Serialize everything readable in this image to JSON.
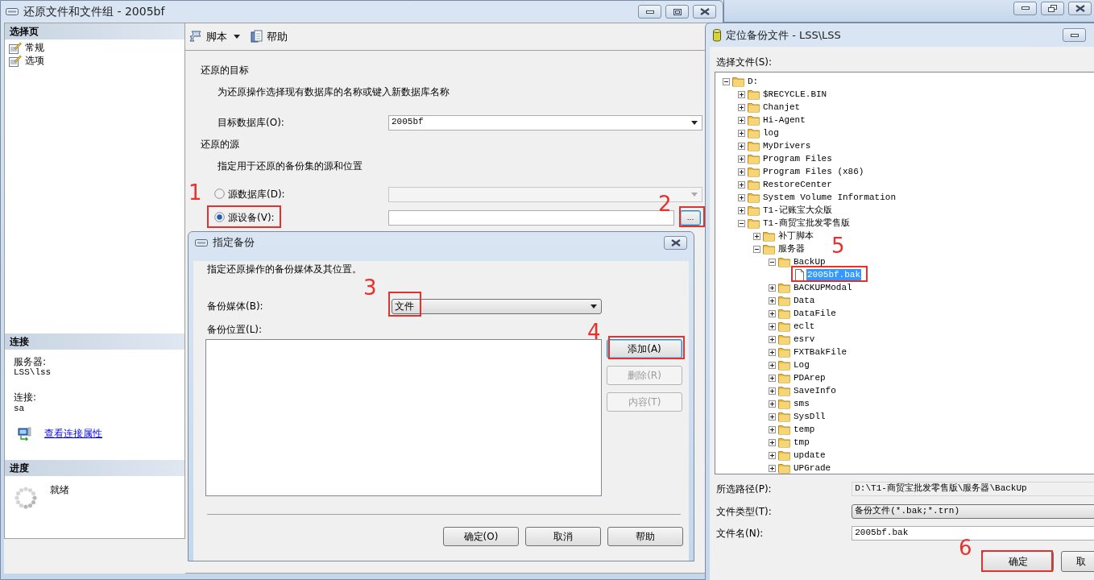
{
  "main_window": {
    "title": "还原文件和文件组 - 2005bf",
    "sidebar": {
      "header": "选择页",
      "items": [
        {
          "label": "常规",
          "selected": false
        },
        {
          "label": "选项",
          "selected": false
        }
      ]
    },
    "connection": {
      "header": "连接",
      "server_label": "服务器:",
      "server": "LSS\\lss",
      "login_label": "连接:",
      "login": "sa",
      "link": "查看连接属性"
    },
    "progress": {
      "header": "进度",
      "status": "就绪"
    },
    "toolbar": [
      {
        "label": "脚本",
        "kind": "script",
        "dropdown": true
      },
      {
        "label": "帮助",
        "kind": "help"
      }
    ],
    "destination": {
      "heading": "还原的目标",
      "hint": "为还原操作选择现有数据库的名称或键入新数据库名称",
      "database_label": "目标数据库(O):",
      "database": "2005bf"
    },
    "source": {
      "heading": "还原的源",
      "hint": "指定用于还原的备份集的源和位置",
      "options": [
        {
          "label": "源数据库(D):",
          "selected": false,
          "kind": "combo",
          "disabled": true
        },
        {
          "label": "源设备(V):",
          "selected": true,
          "kind": "browse",
          "disabled": false,
          "browse_button": "..."
        }
      ]
    }
  },
  "specify_dialog": {
    "title": "指定备份",
    "description": "指定还原操作的备份媒体及其位置。",
    "media_label": "备份媒体(B):",
    "media": "文件",
    "location_label": "备份位置(L):",
    "side_buttons": [
      {
        "label": "添加(A)",
        "disabled": false
      },
      {
        "label": "删除(R)",
        "disabled": true
      },
      {
        "label": "内容(T)",
        "disabled": true
      }
    ],
    "buttons": [
      {
        "label": "确定(O)"
      },
      {
        "label": "取消"
      },
      {
        "label": "帮助"
      }
    ]
  },
  "locate_dialog": {
    "title": "定位备份文件 - LSS\\LSS",
    "tree_label": "选择文件(S):",
    "tree": [
      {
        "label": "D:",
        "kind": "folder",
        "expanded": true,
        "selected": false,
        "children": [
          {
            "label": "$RECYCLE.BIN",
            "kind": "folder",
            "expanded": false,
            "selected": false
          },
          {
            "label": "Chanjet",
            "kind": "folder",
            "expanded": false,
            "selected": false
          },
          {
            "label": "Hi-Agent",
            "kind": "folder",
            "expanded": false,
            "selected": false
          },
          {
            "label": "log",
            "kind": "folder",
            "expanded": false,
            "selected": false
          },
          {
            "label": "MyDrivers",
            "kind": "folder",
            "expanded": false,
            "selected": false
          },
          {
            "label": "Program Files",
            "kind": "folder",
            "expanded": false,
            "selected": false
          },
          {
            "label": "Program Files (x86)",
            "kind": "folder",
            "expanded": false,
            "selected": false
          },
          {
            "label": "RestoreCenter",
            "kind": "folder",
            "expanded": false,
            "selected": false
          },
          {
            "label": "System Volume Information",
            "kind": "folder",
            "expanded": false,
            "selected": false
          },
          {
            "label": "T1-记账宝大众版",
            "kind": "folder",
            "expanded": false,
            "selected": false
          },
          {
            "label": "T1-商贸宝批发零售版",
            "kind": "folder",
            "expanded": true,
            "selected": false,
            "children": [
              {
                "label": "补丁脚本",
                "kind": "folder",
                "expanded": false,
                "selected": false
              },
              {
                "label": "服务器",
                "kind": "folder",
                "expanded": true,
                "selected": false,
                "children": [
                  {
                    "label": "BackUp",
                    "kind": "folder",
                    "expanded": true,
                    "selected": false,
                    "children": [
                      {
                        "label": "2005bf.bak",
                        "kind": "file",
                        "selected": true
                      }
                    ]
                  },
                  {
                    "label": "BACKUPModal",
                    "kind": "folder",
                    "expanded": false,
                    "selected": false
                  },
                  {
                    "label": "Data",
                    "kind": "folder",
                    "expanded": false,
                    "selected": false
                  },
                  {
                    "label": "DataFile",
                    "kind": "folder",
                    "expanded": false,
                    "selected": false
                  },
                  {
                    "label": "eclt",
                    "kind": "folder",
                    "expanded": false,
                    "selected": false
                  },
                  {
                    "label": "esrv",
                    "kind": "folder",
                    "expanded": false,
                    "selected": false
                  },
                  {
                    "label": "FXTBakFile",
                    "kind": "folder",
                    "expanded": false,
                    "selected": false
                  },
                  {
                    "label": "Log",
                    "kind": "folder",
                    "expanded": false,
                    "selected": false
                  },
                  {
                    "label": "PDArep",
                    "kind": "folder",
                    "expanded": false,
                    "selected": false
                  },
                  {
                    "label": "SaveInfo",
                    "kind": "folder",
                    "expanded": false,
                    "selected": false
                  },
                  {
                    "label": "sms",
                    "kind": "folder",
                    "expanded": false,
                    "selected": false
                  },
                  {
                    "label": "SysDll",
                    "kind": "folder",
                    "expanded": false,
                    "selected": false
                  },
                  {
                    "label": "temp",
                    "kind": "folder",
                    "expanded": false,
                    "selected": false
                  },
                  {
                    "label": "tmp",
                    "kind": "folder",
                    "expanded": false,
                    "selected": false
                  },
                  {
                    "label": "update",
                    "kind": "folder",
                    "expanded": false,
                    "selected": false
                  },
                  {
                    "label": "UPGrade",
                    "kind": "folder",
                    "expanded": false,
                    "selected": false
                  }
                ]
              }
            ]
          }
        ]
      }
    ],
    "path_label": "所选路径(P):",
    "path": "D:\\T1-商贸宝批发零售版\\服务器\\BackUp",
    "type_label": "文件类型(T):",
    "type": "备份文件(*.bak;*.trn)",
    "name_label": "文件名(N):",
    "name": "2005bf.bak",
    "buttons": [
      {
        "label": "确定"
      },
      {
        "label": "取"
      }
    ]
  },
  "annotations": [
    {
      "label": "1"
    },
    {
      "label": "2"
    },
    {
      "label": "3"
    },
    {
      "label": "4"
    },
    {
      "label": "5"
    },
    {
      "label": "6"
    }
  ]
}
